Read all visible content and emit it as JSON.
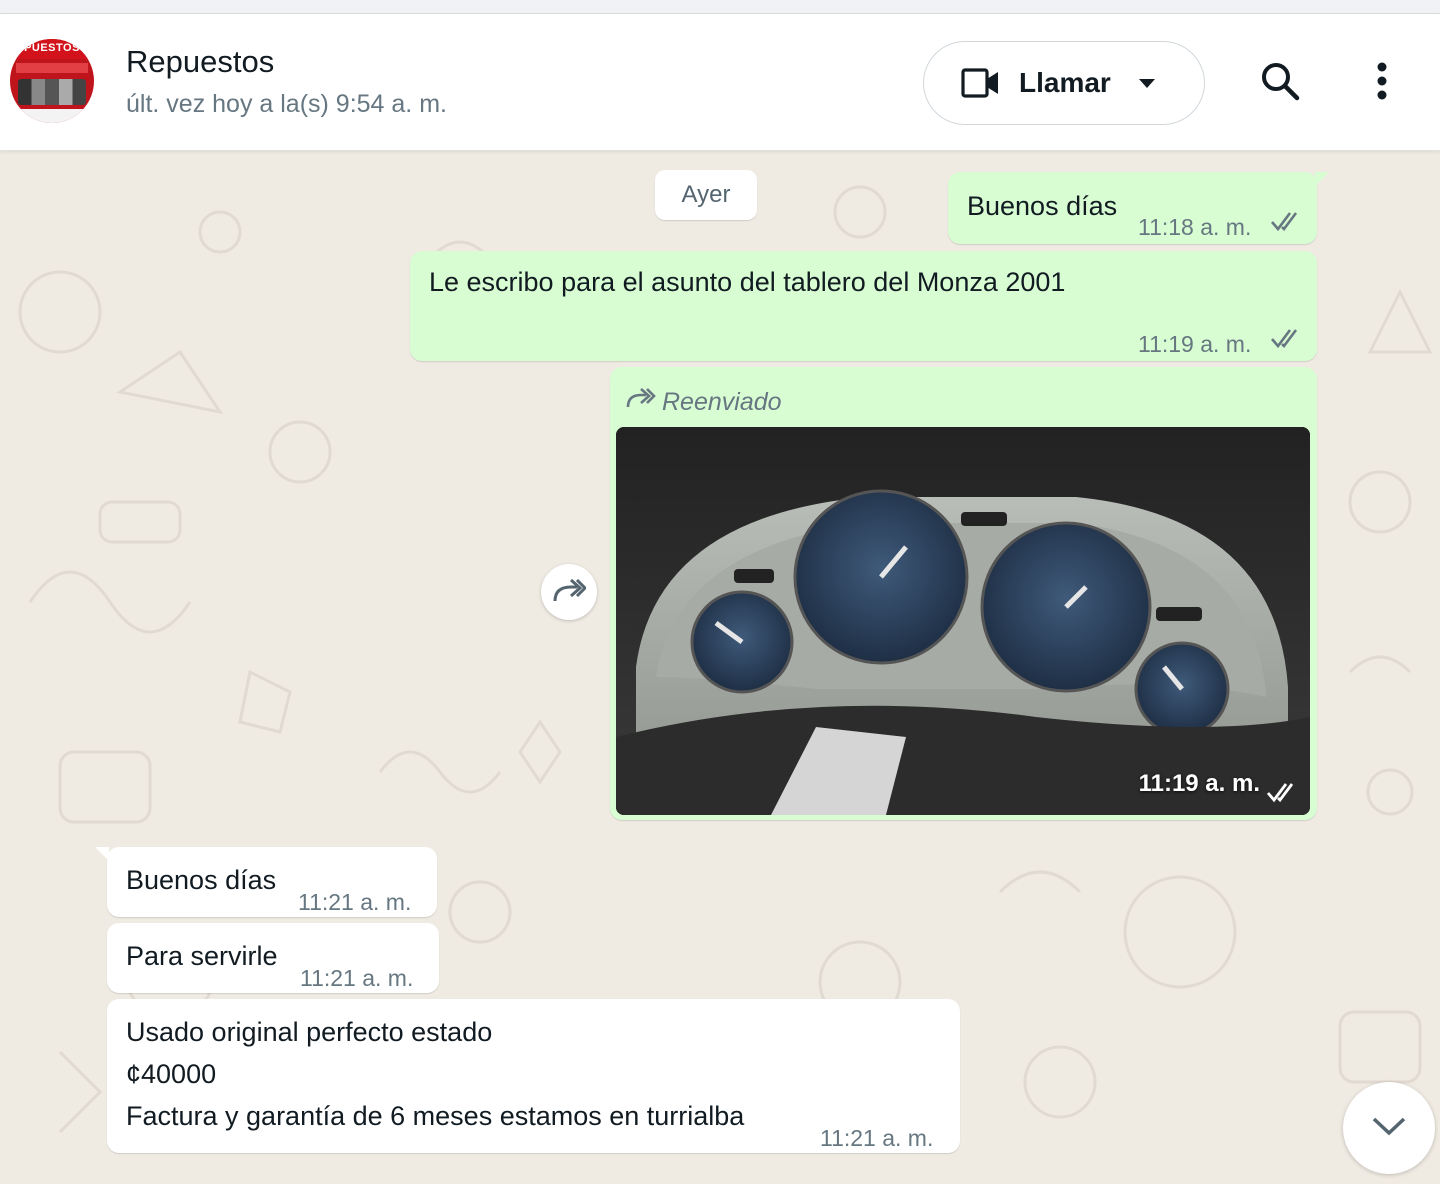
{
  "header": {
    "contact_name": "Repuestos",
    "avatar_text": "PUESTOS",
    "status": "últ. vez hoy a la(s) 9:54 a. m.",
    "call_label": "Llamar",
    "icons": [
      "video-camera-icon",
      "caret-down-icon",
      "search-icon",
      "kebab-menu-icon"
    ]
  },
  "chat": {
    "date_separator": "Ayer",
    "messages": [
      {
        "direction": "outgoing",
        "text": "Buenos días",
        "time": "11:18 a. m.",
        "status": "read"
      },
      {
        "direction": "outgoing",
        "text": "Le escribo para el asunto del tablero del Monza 2001",
        "time": "11:19 a. m.",
        "status": "read"
      },
      {
        "direction": "outgoing",
        "type": "image",
        "forwarded_label": "Reenviado",
        "time": "11:19 a. m.",
        "status": "read"
      },
      {
        "direction": "incoming",
        "text": "Buenos días",
        "time": "11:21 a. m."
      },
      {
        "direction": "incoming",
        "text": "Para servirle",
        "time": "11:21 a. m."
      },
      {
        "direction": "incoming",
        "lines": [
          "Usado original perfecto estado",
          "¢40000",
          "Factura y garantía de 6 meses estamos en turrialba"
        ],
        "time": "11:21 a. m."
      }
    ]
  },
  "colors": {
    "outgoing_bubble": "#d9fdd3",
    "incoming_bubble": "#ffffff",
    "chat_background": "#efeae2",
    "read_ticks": "#667781"
  }
}
